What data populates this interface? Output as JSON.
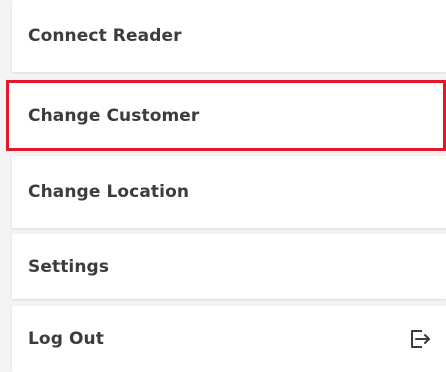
{
  "menu": {
    "items": [
      {
        "label": "Connect Reader"
      },
      {
        "label": "Change Customer"
      },
      {
        "label": "Change Location"
      },
      {
        "label": "Settings"
      },
      {
        "label": "Log Out",
        "icon": "logout-icon"
      }
    ],
    "highlight_color": "#e3182c"
  }
}
